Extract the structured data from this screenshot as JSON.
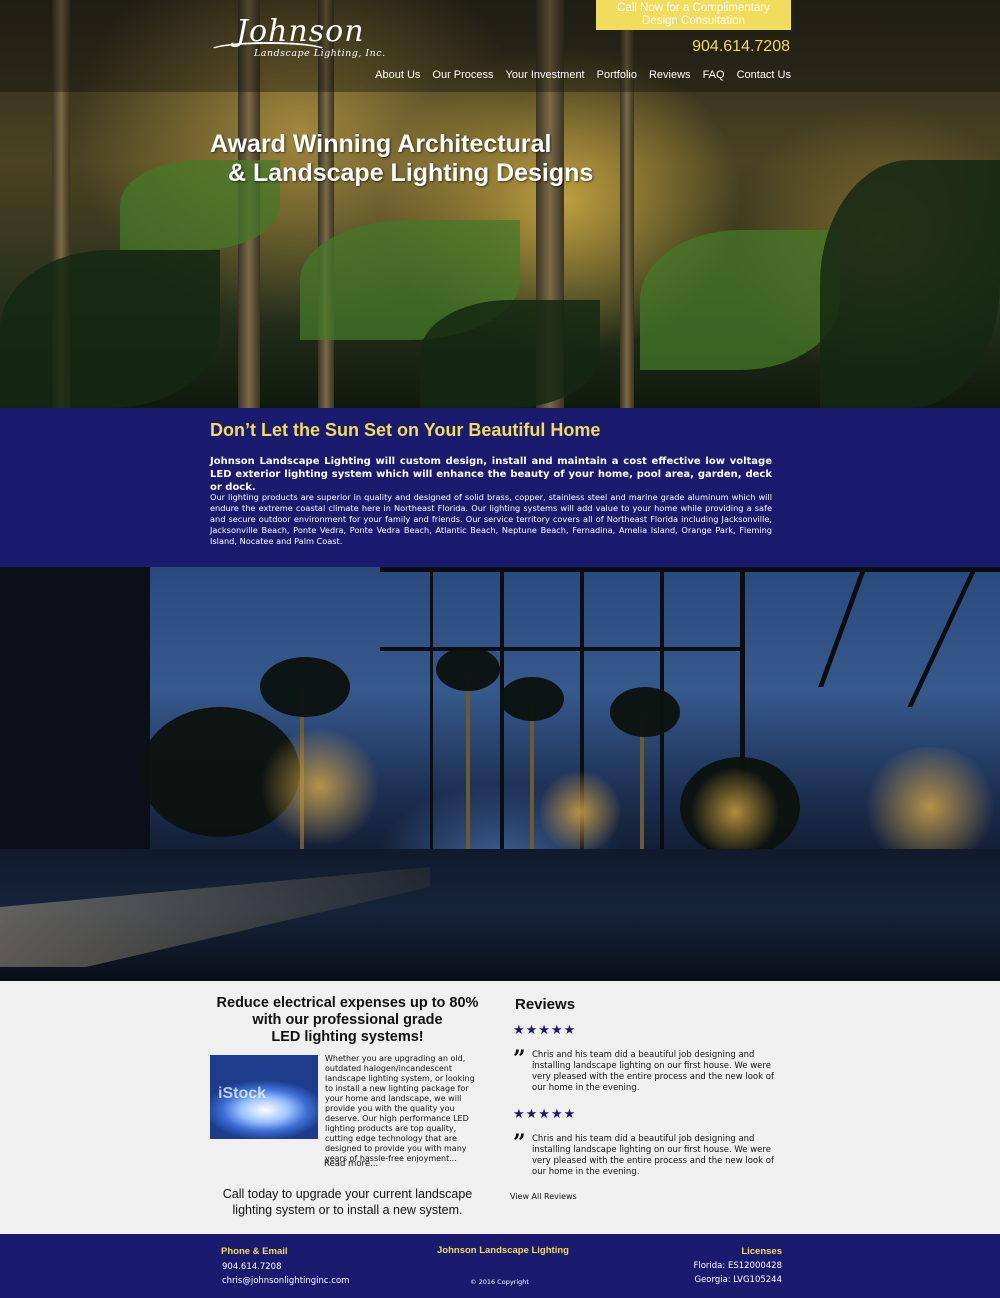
{
  "brand": {
    "logo_script": "Johnson",
    "logo_sub": "Landscape Lighting, Inc."
  },
  "header": {
    "cta_line1": "Call Now for a Complimentary",
    "cta_line2": "Design Consultation",
    "phone": "904.614.7208",
    "nav": [
      "About Us",
      "Our Process",
      "Your Investment",
      "Portfolio",
      "Reviews",
      "FAQ",
      "Contact Us"
    ]
  },
  "hero": {
    "title_line1": "Award Winning Architectural",
    "title_line2": "& Landscape Lighting Designs"
  },
  "intro": {
    "heading": "Don’t Let the Sun Set on Your Beautiful Home",
    "lead": "Johnson Landscape Lighting will custom design, install and maintain a cost effective low voltage LED exterior lighting system which will enhance the beauty of your home, pool area, garden, deck or dock.",
    "body": "Our lighting products are superior in quality and designed of solid brass, copper, stainless steel and marine grade aluminum which will endure the extreme coastal climate here in Northeast Florida.  Our lighting systems will add value to your home while providing a safe and secure outdoor environment for your family and friends.  Our service territory covers all of Northeast Florida including Jacksonville, Jacksonville Beach, Ponte Vedra, Ponte Vedra Beach, Atlantic Beach, Neptune Beach, Fernadina, Amelia Island, Orange Park, Fleming Island, Nocatee and Palm Coast."
  },
  "promo": {
    "title_line1": "Reduce electrical expenses up to 80%",
    "title_line2": "with our professional grade",
    "title_line3": "LED lighting systems!",
    "image_watermark": "iStock",
    "text": "Whether you are upgrading an old, outdated halogen/incandescent landscape lighting system, or looking to install a new lighting package for your home and landscape, we will provide you with the quality you deserve.  Our high performance LED lighting products are top quality, cutting edge technology that are designed to provide you with many years of hassle-free enjoyment...",
    "read_more": "Read more...",
    "call_today": "Call today to upgrade your current landscape lighting system or to install a new system."
  },
  "reviews": {
    "title": "Reviews",
    "rating_stars": 5,
    "star_glyphs": "★★★★★",
    "quote_glyph": "”",
    "items": [
      {
        "text": "Chris and his team did a beautiful job designing and installing landscape lighting on our first house.  We were very pleased with the entire process and the new look of our home in the evening."
      },
      {
        "text": "Chris and his team did a beautiful job designing and installing landscape lighting on our first house.  We were very pleased with the entire process and the new look of our home in the evening."
      }
    ],
    "view_all": "View All Reviews"
  },
  "footer": {
    "contact_heading": "Phone & Email",
    "phone": "904.614.7208",
    "email": "chris@johnsonlightinginc.com",
    "company": "Johnson Landscape Lighting",
    "copyright": "© 2016 Copyright",
    "licenses_heading": "Licenses",
    "license_fl": "Florida: ES12000428",
    "license_ga": "Georgia: LVG105244"
  },
  "colors": {
    "accent_yellow": "#f2dc5d",
    "navy": "#1a1a6e",
    "light_bg": "#f0f0f0"
  }
}
